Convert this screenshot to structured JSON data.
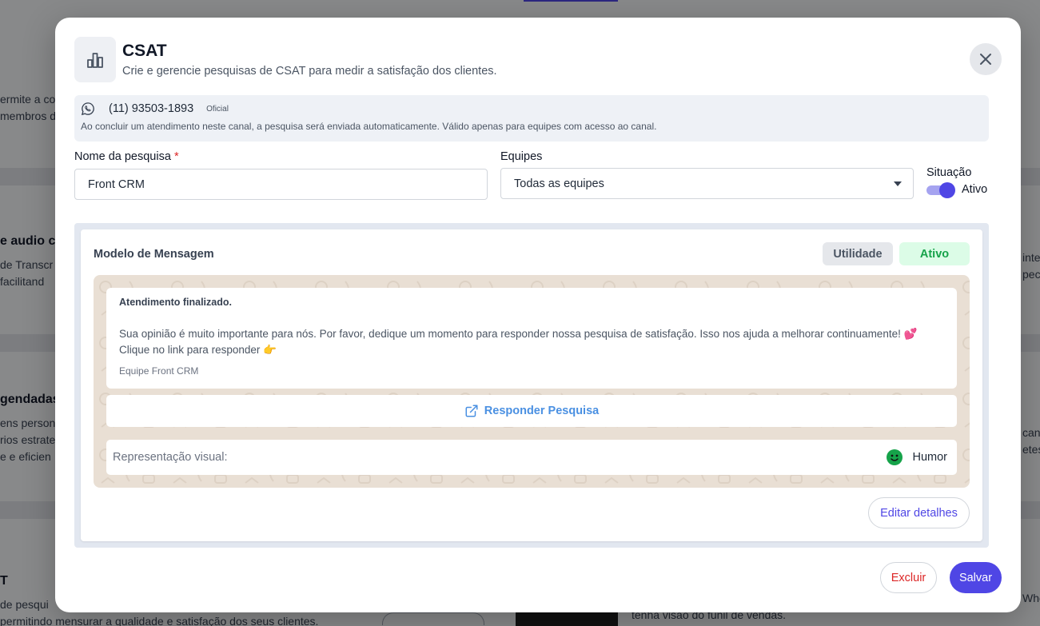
{
  "background": {
    "texts": [
      {
        "id": "bg-1",
        "text": "ermite a co"
      },
      {
        "id": "bg-2",
        "text": "membros d"
      },
      {
        "id": "bg-3",
        "text": "e audio co"
      },
      {
        "id": "bg-4",
        "text": "de Transcr"
      },
      {
        "id": "bg-5",
        "text": " facilitand"
      },
      {
        "id": "bg-6",
        "text": "gendadas"
      },
      {
        "id": "bg-7",
        "text": "ens person"
      },
      {
        "id": "bg-8",
        "text": "rios estrate"
      },
      {
        "id": "bg-9",
        "text": "e e eficien"
      },
      {
        "id": "bg-10",
        "text": "T"
      },
      {
        "id": "bg-11",
        "text": "de pesqui"
      },
      {
        "id": "bg-12",
        "text": "permitindo mensurar a qualidade e satisfação dos seus clientes."
      },
      {
        "id": "bg-13",
        "text": "inte"
      },
      {
        "id": "bg-14",
        "text": "peci"
      },
      {
        "id": "bg-15",
        "text": "cana"
      },
      {
        "id": "bg-16",
        "text": "etes."
      },
      {
        "id": "bg-17",
        "text": "Who"
      },
      {
        "id": "bg-18",
        "text": "tenha visão do funil de vendas."
      }
    ]
  },
  "modal": {
    "title": "CSAT",
    "subtitle": "Crie e gerencie pesquisas de CSAT para medir a satisfação dos clientes.",
    "header_icon": "bar-chart-icon",
    "channel": {
      "icon": "whatsapp-icon",
      "phone": "(11) 93503-1893",
      "tag": "Oficial",
      "note": "Ao concluir um atendimento neste canal, a pesquisa será enviada automaticamente. Válido apenas para equipes com acesso ao canal."
    },
    "form": {
      "name_label": "Nome da pesquisa",
      "name_required": "*",
      "name_value": "Front CRM",
      "teams_label": "Equipes",
      "teams_value": "Todas as equipes",
      "status_label": "Situação",
      "status_value": "Ativo",
      "status_on": true
    },
    "template": {
      "title": "Modelo de Mensagem",
      "badge_category": "Utilidade",
      "badge_status": "Ativo",
      "message": {
        "header": "Atendimento finalizado.",
        "body_line1": "Sua opinião é muito importante para nós. Por favor, dedique um momento para responder nossa pesquisa de satisfação. Isso nos ajuda a melhorar continuamente! 💕",
        "body_line2": "Clique no link para responder 👉",
        "footer": "Equipe Front CRM"
      },
      "link_button": "Responder Pesquisa",
      "visual_label": "Representação visual:",
      "visual_value": "Humor",
      "edit_button": "Editar detalhes"
    },
    "actions": {
      "delete": "Excluir",
      "save": "Salvar"
    }
  },
  "colors": {
    "primary": "#4f46e5",
    "danger": "#dc2626",
    "success": "#16a34a",
    "link": "#4a90e2",
    "chat_bg": "#e9dfd4"
  }
}
